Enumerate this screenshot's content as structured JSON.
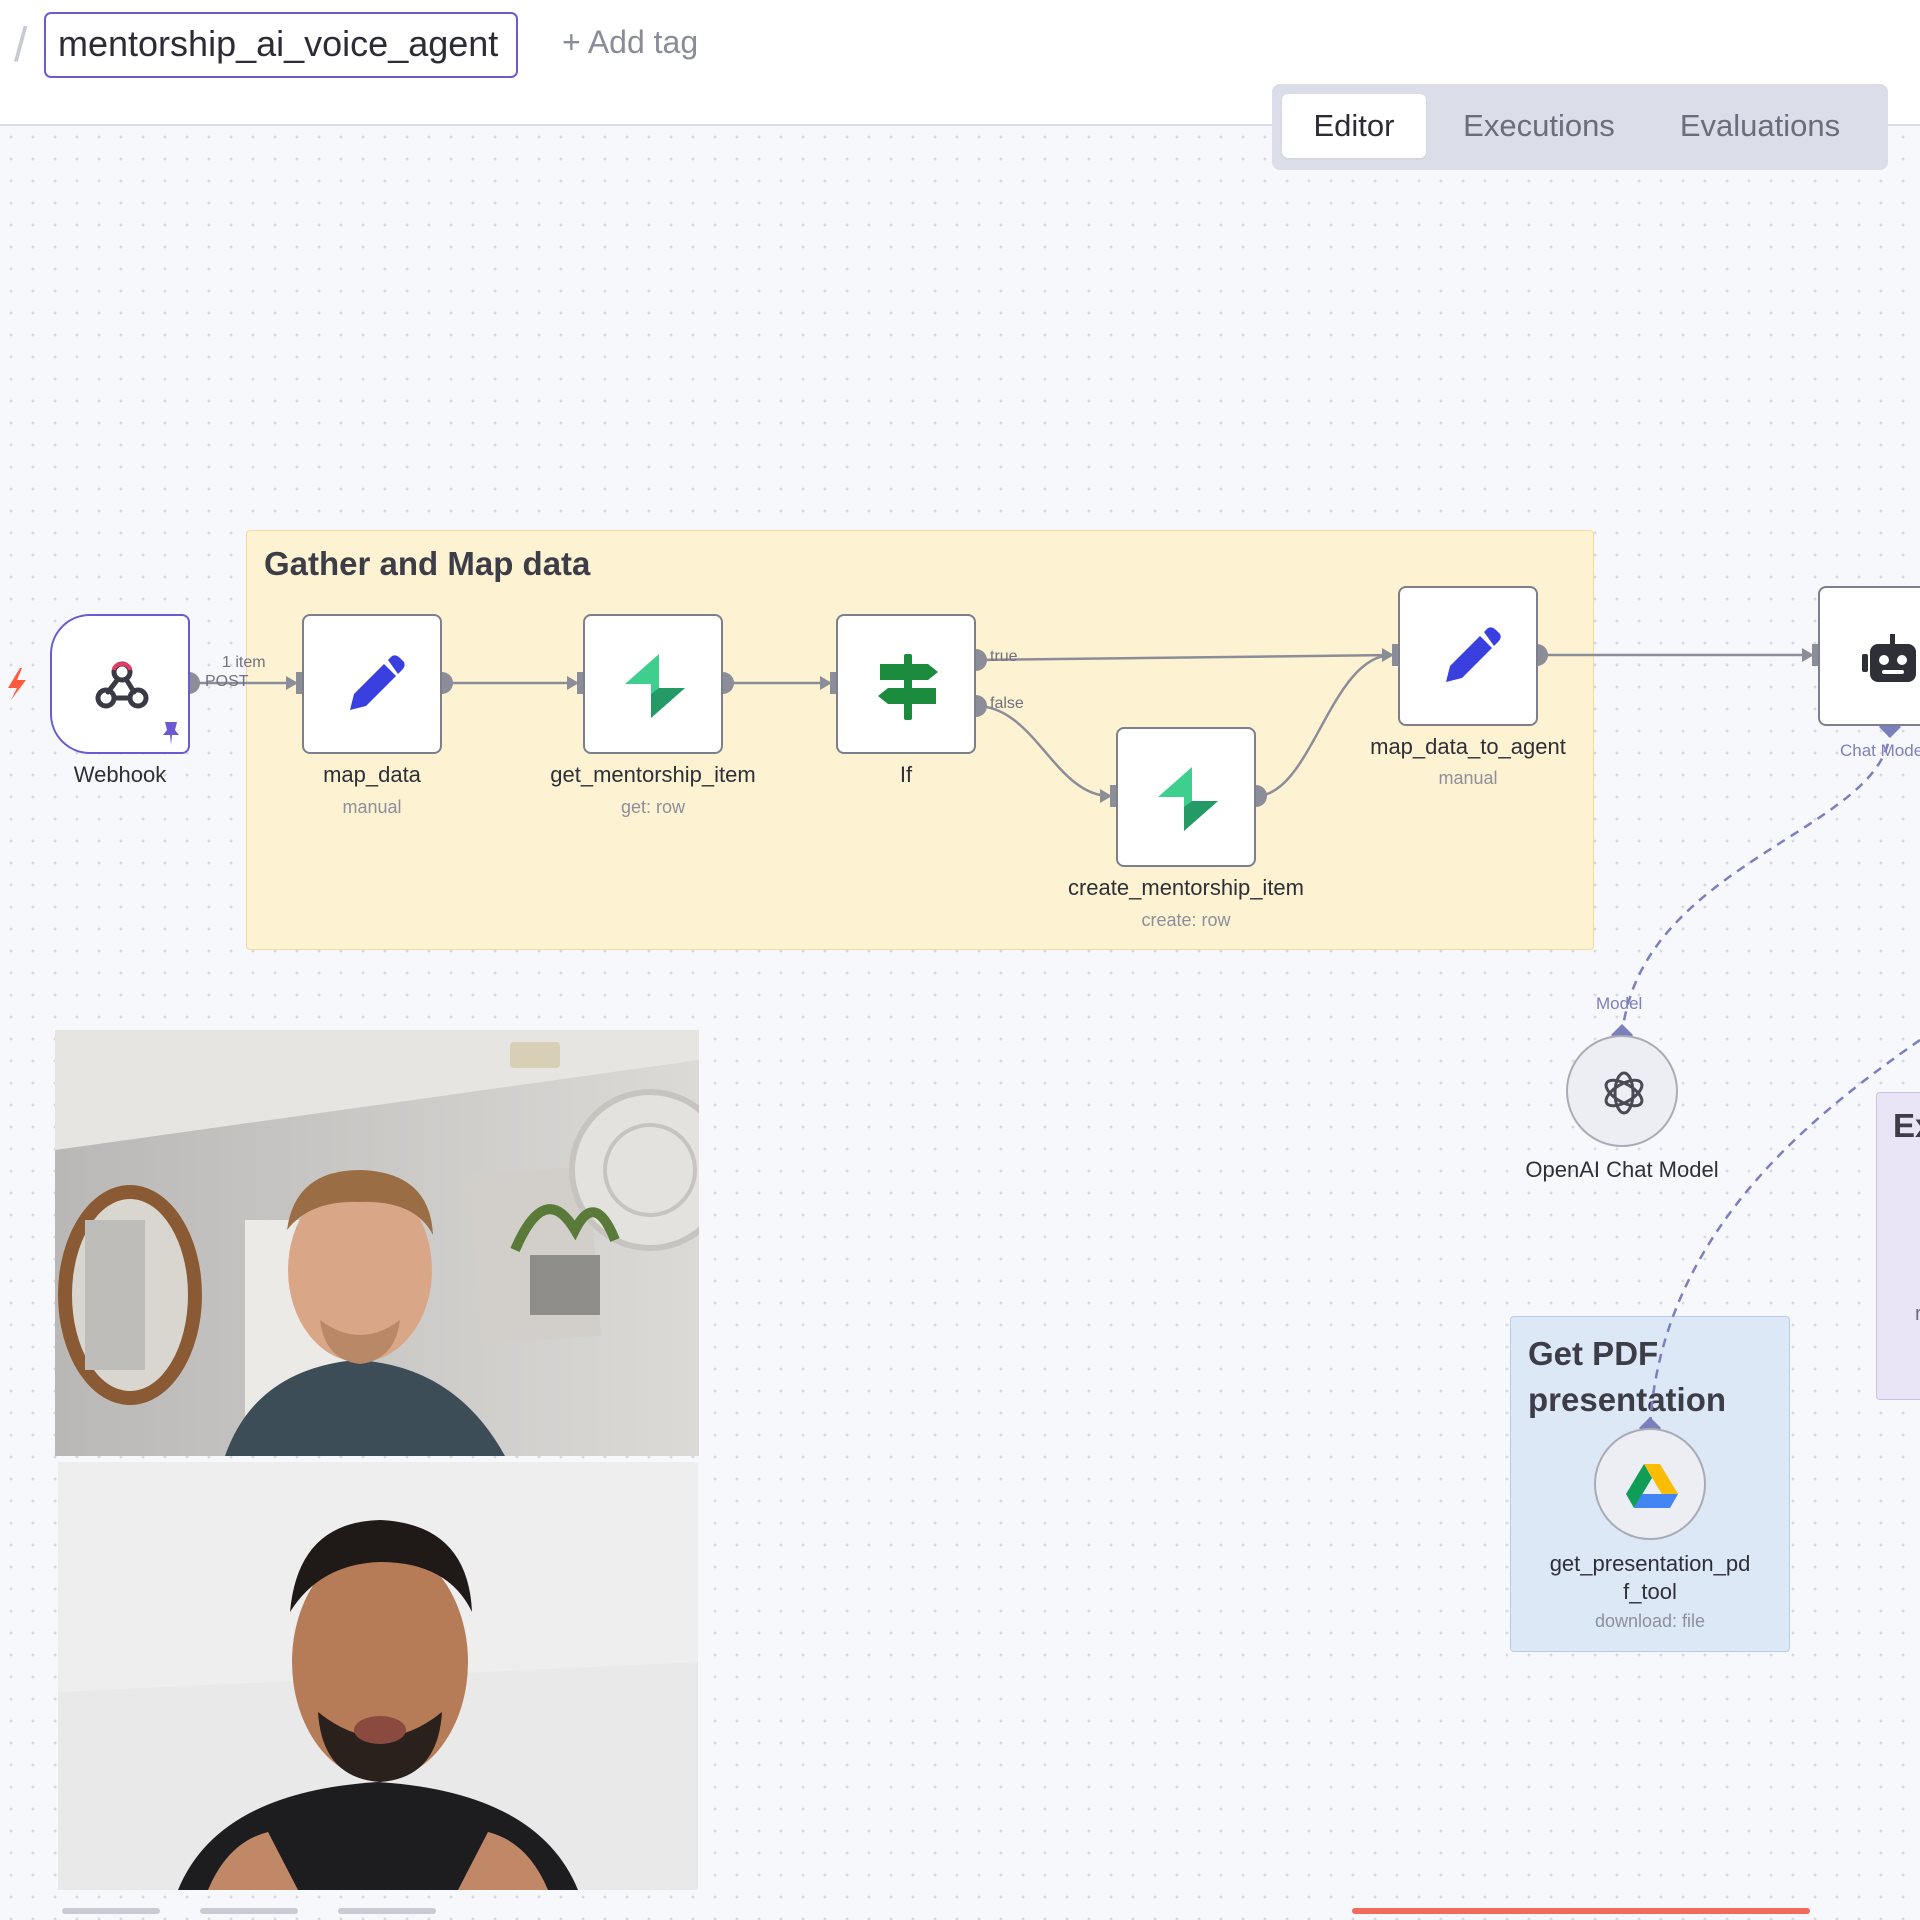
{
  "header": {
    "breadcrumb_separator": "/",
    "workflow_name": "mentorship_ai_voice_agent",
    "add_tag_label": "+ Add tag"
  },
  "tabs": [
    {
      "label": "Editor",
      "active": true
    },
    {
      "label": "Executions",
      "active": false
    },
    {
      "label": "Evaluations",
      "active": false
    }
  ],
  "sticky_notes": {
    "gather": {
      "title": "Gather and Map data"
    },
    "pdf": {
      "title_line1": "Get PDF",
      "title_line2": "presentation"
    },
    "partial": {
      "title": "Ex",
      "fragment": "r"
    }
  },
  "nodes": {
    "webhook": {
      "label": "Webhook",
      "icon": "webhook-icon"
    },
    "map_data": {
      "label": "map_data",
      "sub": "manual",
      "icon": "pencil-icon"
    },
    "get_mentorship_item": {
      "label": "get_mentorship_item",
      "sub": "get: row",
      "icon": "supabase-icon"
    },
    "if": {
      "label": "If",
      "icon": "signpost-icon"
    },
    "create_mentorship_item": {
      "label": "create_mentorship_item",
      "sub": "create: row",
      "icon": "supabase-icon"
    },
    "map_data_to_agent": {
      "label": "map_data_to_agent",
      "sub": "manual",
      "icon": "pencil-icon"
    },
    "ai_agent": {
      "label": "",
      "icon": "robot-icon",
      "port_label": "Chat Mode"
    },
    "openai_chat_model": {
      "label": "OpenAI Chat Model",
      "port_label": "Model",
      "icon": "openai-icon"
    },
    "get_presentation_pdf_tool": {
      "label_line1": "get_presentation_pd",
      "label_line2": "f_tool",
      "sub": "download: file",
      "icon": "google-drive-icon"
    }
  },
  "connections": {
    "webhook_items": "1 item",
    "webhook_method": "POST",
    "if_true": "true",
    "if_false": "false"
  },
  "colors": {
    "accent": "#6b5bd2",
    "sticky_yellow": "#fdf3d3",
    "sticky_blue": "#dde8f7",
    "sticky_purple": "#e9e4f6",
    "pencil": "#3a3fe0",
    "supabase": "#3ecf8e",
    "if_green": "#1a8b3c",
    "trigger_red": "#ff5a3c"
  },
  "participants": [
    {
      "name": "",
      "tile": "video-tile-1"
    },
    {
      "name": "",
      "tile": "video-tile-2"
    }
  ]
}
